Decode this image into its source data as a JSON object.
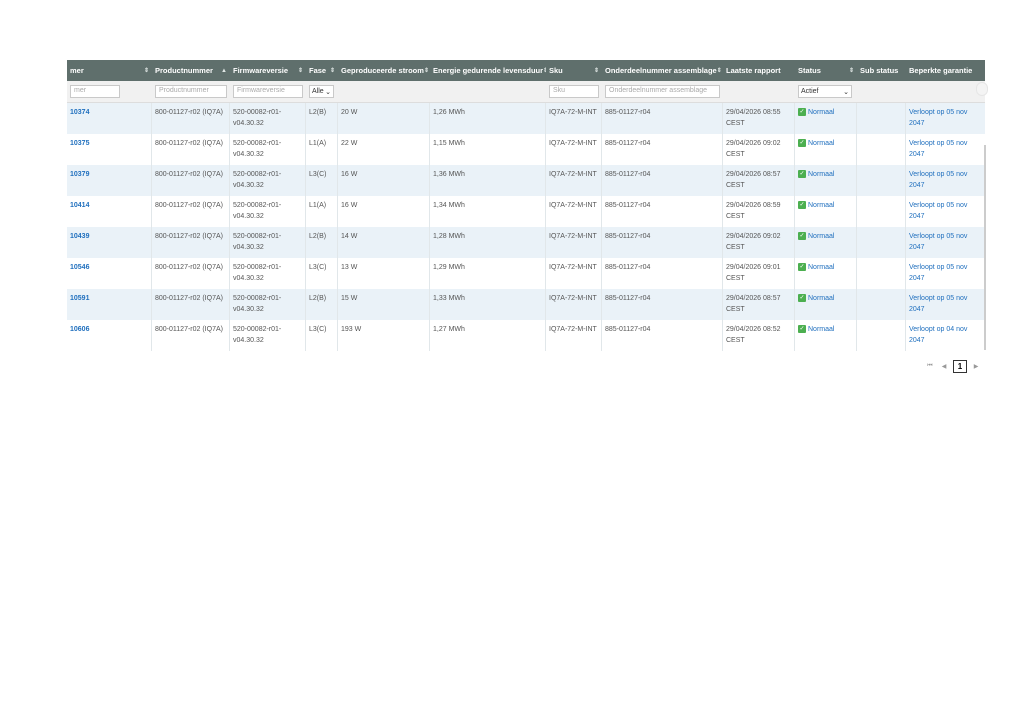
{
  "headers": {
    "serial": "mer",
    "product": "Productnummer",
    "product_sort": "▲",
    "firmware": "Firmwareversie",
    "phase": "Fase",
    "power": "Geproduceerde stroom",
    "energy": "Energie gedurende levensduur",
    "sku": "Sku",
    "assembly": "Onderdeelnummer assemblage",
    "last_report": "Laatste rapport",
    "status": "Status",
    "sub_status": "Sub status",
    "warranty": "Beperkte garantie",
    "sort_glyph": "⇕"
  },
  "filters": {
    "serial_placeholder": "mer",
    "product_placeholder": "Productnummer",
    "firmware_placeholder": "Firmwareversie",
    "phase_value": "Alle",
    "sku_placeholder": "Sku",
    "assembly_placeholder": "Onderdeelnummer assemblage",
    "status_value": "Actief"
  },
  "rows": [
    {
      "serial": "10374",
      "product": "800-01127-r02 (IQ7A)",
      "firmware": "520-00082-r01-v04.30.32",
      "phase": "L2(B)",
      "power": "20 W",
      "energy": "1,26 MWh",
      "sku": "IQ7A-72-M-INT",
      "assembly": "885-01127-r04",
      "last_report": "29/04/2026 08:55 CEST",
      "status": "Normaal",
      "sub_status": "",
      "warranty": "Verloopt op 05 nov 2047"
    },
    {
      "serial": "10375",
      "product": "800-01127-r02 (IQ7A)",
      "firmware": "520-00082-r01-v04.30.32",
      "phase": "L1(A)",
      "power": "22 W",
      "energy": "1,15 MWh",
      "sku": "IQ7A-72-M-INT",
      "assembly": "885-01127-r04",
      "last_report": "29/04/2026 09:02 CEST",
      "status": "Normaal",
      "sub_status": "",
      "warranty": "Verloopt op 05 nov 2047"
    },
    {
      "serial": "10379",
      "product": "800-01127-r02 (IQ7A)",
      "firmware": "520-00082-r01-v04.30.32",
      "phase": "L3(C)",
      "power": "16 W",
      "energy": "1,36 MWh",
      "sku": "IQ7A-72-M-INT",
      "assembly": "885-01127-r04",
      "last_report": "29/04/2026 08:57 CEST",
      "status": "Normaal",
      "sub_status": "",
      "warranty": "Verloopt op 05 nov 2047"
    },
    {
      "serial": "10414",
      "product": "800-01127-r02 (IQ7A)",
      "firmware": "520-00082-r01-v04.30.32",
      "phase": "L1(A)",
      "power": "16 W",
      "energy": "1,34 MWh",
      "sku": "IQ7A-72-M-INT",
      "assembly": "885-01127-r04",
      "last_report": "29/04/2026 08:59 CEST",
      "status": "Normaal",
      "sub_status": "",
      "warranty": "Verloopt op 05 nov 2047"
    },
    {
      "serial": "10439",
      "product": "800-01127-r02 (IQ7A)",
      "firmware": "520-00082-r01-v04.30.32",
      "phase": "L2(B)",
      "power": "14 W",
      "energy": "1,28 MWh",
      "sku": "IQ7A-72-M-INT",
      "assembly": "885-01127-r04",
      "last_report": "29/04/2026 09:02 CEST",
      "status": "Normaal",
      "sub_status": "",
      "warranty": "Verloopt op 05 nov 2047"
    },
    {
      "serial": "10546",
      "product": "800-01127-r02 (IQ7A)",
      "firmware": "520-00082-r01-v04.30.32",
      "phase": "L3(C)",
      "power": "13 W",
      "energy": "1,29 MWh",
      "sku": "IQ7A-72-M-INT",
      "assembly": "885-01127-r04",
      "last_report": "29/04/2026 09:01 CEST",
      "status": "Normaal",
      "sub_status": "",
      "warranty": "Verloopt op 05 nov 2047"
    },
    {
      "serial": "10591",
      "product": "800-01127-r02 (IQ7A)",
      "firmware": "520-00082-r01-v04.30.32",
      "phase": "L2(B)",
      "power": "15 W",
      "energy": "1,33 MWh",
      "sku": "IQ7A-72-M-INT",
      "assembly": "885-01127-r04",
      "last_report": "29/04/2026 08:57 CEST",
      "status": "Normaal",
      "sub_status": "",
      "warranty": "Verloopt op 05 nov 2047"
    },
    {
      "serial": "10606",
      "product": "800-01127-r02 (IQ7A)",
      "firmware": "520-00082-r01-v04.30.32",
      "phase": "L3(C)",
      "power": "193 W",
      "energy": "1,27 MWh",
      "sku": "IQ7A-72-M-INT",
      "assembly": "885-01127-r04",
      "last_report": "29/04/2026 08:52 CEST",
      "status": "Normaal",
      "sub_status": "",
      "warranty": "Verloopt op 04 nov 2047"
    }
  ],
  "pager": {
    "first": "⏮",
    "prev": "◀",
    "page": "1",
    "next": "▶"
  },
  "icons": {
    "status_ok": "check-icon",
    "accent": "#1f6fbe",
    "header_bg": "#5f6f6c",
    "status_color": "#4caf50"
  }
}
